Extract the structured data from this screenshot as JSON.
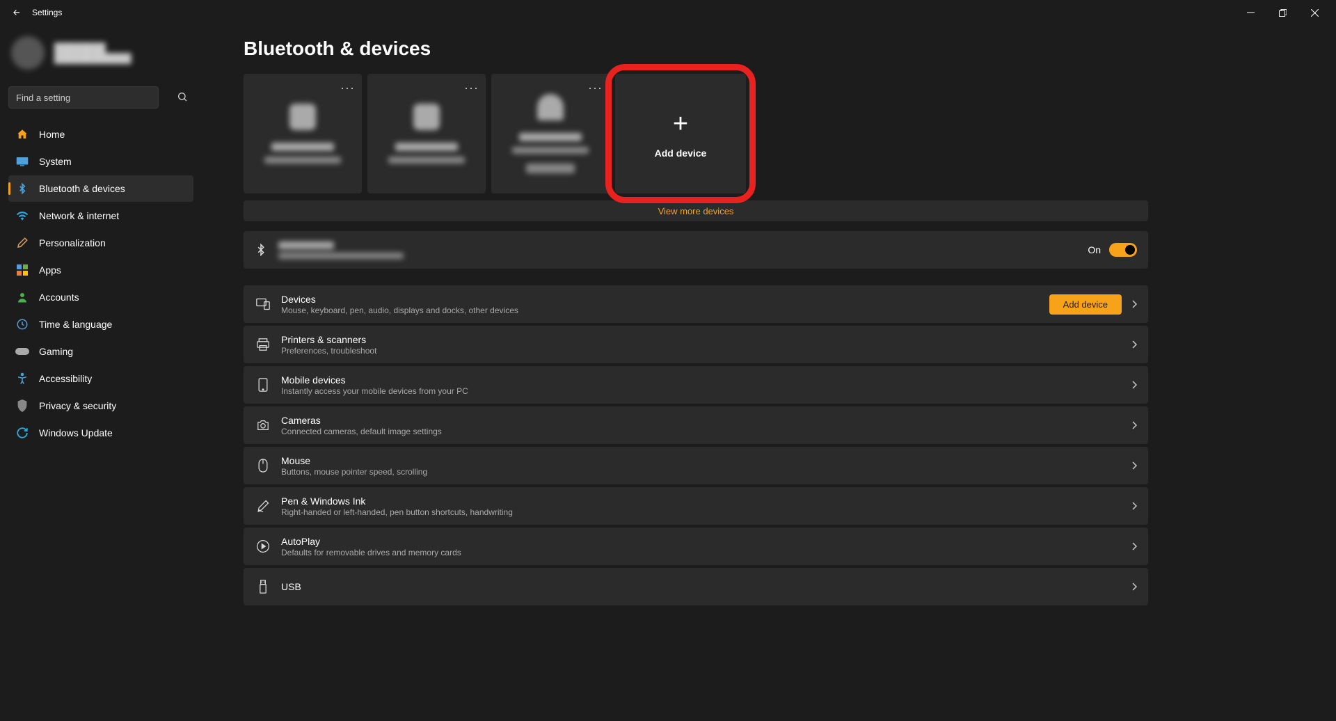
{
  "window": {
    "title": "Settings"
  },
  "search": {
    "placeholder": "Find a setting"
  },
  "nav": [
    {
      "key": "home",
      "label": "Home",
      "icon": "🏠"
    },
    {
      "key": "system",
      "label": "System",
      "icon": "💻"
    },
    {
      "key": "bluetooth",
      "label": "Bluetooth & devices",
      "icon": "BT",
      "active": true
    },
    {
      "key": "network",
      "label": "Network & internet",
      "icon": "📶"
    },
    {
      "key": "personalization",
      "label": "Personalization",
      "icon": "🖌️"
    },
    {
      "key": "apps",
      "label": "Apps",
      "icon": "▦"
    },
    {
      "key": "accounts",
      "label": "Accounts",
      "icon": "👤"
    },
    {
      "key": "time",
      "label": "Time & language",
      "icon": "🕓"
    },
    {
      "key": "gaming",
      "label": "Gaming",
      "icon": "🎮"
    },
    {
      "key": "accessibility",
      "label": "Accessibility",
      "icon": "⁂"
    },
    {
      "key": "privacy",
      "label": "Privacy & security",
      "icon": "🛡️"
    },
    {
      "key": "update",
      "label": "Windows Update",
      "icon": "🔄"
    }
  ],
  "page": {
    "title": "Bluetooth & devices",
    "add_device_card": "Add device",
    "view_more": "View more devices",
    "bt_status_label": "On",
    "add_device_btn": "Add device"
  },
  "settings_items": [
    {
      "key": "devices",
      "title": "Devices",
      "sub": "Mouse, keyboard, pen, audio, displays and docks, other devices",
      "action": "button"
    },
    {
      "key": "printers",
      "title": "Printers & scanners",
      "sub": "Preferences, troubleshoot"
    },
    {
      "key": "mobile",
      "title": "Mobile devices",
      "sub": "Instantly access your mobile devices from your PC"
    },
    {
      "key": "cameras",
      "title": "Cameras",
      "sub": "Connected cameras, default image settings"
    },
    {
      "key": "mouse",
      "title": "Mouse",
      "sub": "Buttons, mouse pointer speed, scrolling"
    },
    {
      "key": "pen",
      "title": "Pen & Windows Ink",
      "sub": "Right-handed or left-handed, pen button shortcuts, handwriting"
    },
    {
      "key": "autoplay",
      "title": "AutoPlay",
      "sub": "Defaults for removable drives and memory cards"
    },
    {
      "key": "usb",
      "title": "USB",
      "sub": ""
    }
  ]
}
